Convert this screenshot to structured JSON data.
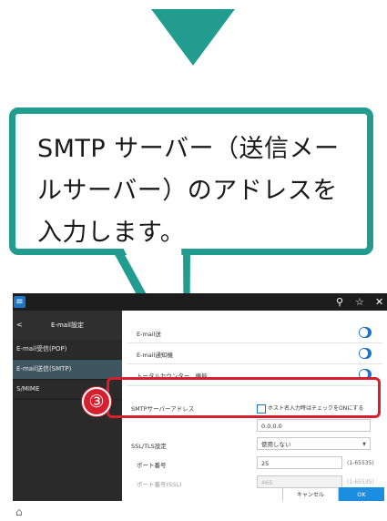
{
  "callout": {
    "line1": "SMTP サーバー（送信メー",
    "line2": "ルサーバー）のアドレスを",
    "line3": "入力します。"
  },
  "step_marker": "③",
  "topbar": {
    "menu_icon": "menu-icon",
    "search_icon": "search-icon",
    "star_icon": "star-icon",
    "close_icon": "close-icon"
  },
  "sidebar": {
    "back": "<",
    "title": "E-mail設定",
    "items": [
      "E-mail受信(POP)",
      "E-mail送信(SMTP)",
      "S/MIME"
    ]
  },
  "content": {
    "row1": "E-mail送",
    "row2": "E-mail通知機",
    "row3": "トータルカウンター　機能",
    "smtp_label": "SMTPサーバーアドレス",
    "hostname_check": "ホスト名入力時はチェックをONにする",
    "smtp_value": "0.0.0.0",
    "ssl_label": "SSL/TLS設定",
    "ssl_value": "使用しない",
    "port_label": "ポート番号",
    "port_value": "25",
    "port_range": "(1-65535)",
    "port_ssl_label": "ポート番号(SSL)",
    "port_ssl_value": "465",
    "port_ssl_range": "(1-65535)",
    "cancel": "キャンセル",
    "ok": "OK"
  },
  "colors": {
    "accent": "#229c8e",
    "highlight": "#d6202f",
    "primary_button": "#1b8ee0"
  }
}
